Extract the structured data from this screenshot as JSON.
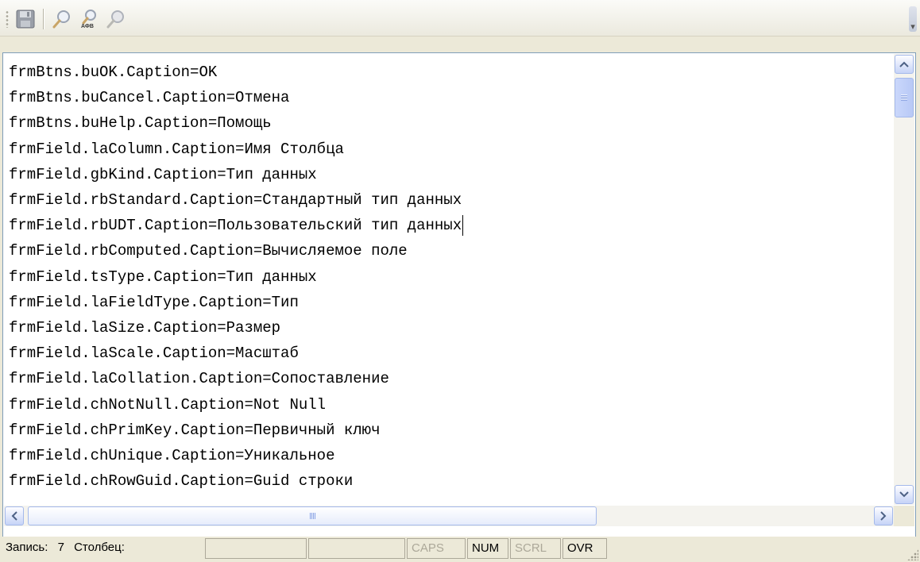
{
  "toolbar": {
    "buttons": [
      {
        "icon": "save-icon"
      },
      {
        "icon": "search-icon"
      },
      {
        "icon": "search-abc-icon",
        "label": "АФВ"
      },
      {
        "icon": "search-next-icon"
      }
    ]
  },
  "editor": {
    "lines": [
      "frmBtns.buOK.Caption=OK",
      "frmBtns.buCancel.Caption=Отмена",
      "frmBtns.buHelp.Caption=Помощь",
      "frmField.laColumn.Caption=Имя Столбца",
      "frmField.gbKind.Caption=Тип данных",
      "frmField.rbStandard.Caption=Стандартный тип данных",
      "frmField.rbUDT.Caption=Пользовательский тип данных",
      "frmField.rbComputed.Caption=Вычисляемое поле",
      "frmField.tsType.Caption=Тип данных",
      "frmField.laFieldType.Caption=Тип",
      "frmField.laSize.Caption=Размер",
      "frmField.laScale.Caption=Масштаб",
      "frmField.laCollation.Caption=Сопоставление",
      "frmField.chNotNull.Caption=Not Null",
      "frmField.chPrimKey.Caption=Первичный ключ",
      "frmField.chUnique.Caption=Уникальное",
      "frmField.chRowGuid.Caption=Guid строки"
    ],
    "caret_line": 7
  },
  "status": {
    "record_label": "Запись:",
    "record_value": "7",
    "column_label": "Столбец:",
    "column_value": "",
    "empty_panel": "",
    "caps": "CAPS",
    "num": "NUM",
    "scrl": "SCRL",
    "ovr": "OVR"
  },
  "colors": {
    "frame_border": "#7f9db9",
    "scroll_accent": "#a4b9eb",
    "disabled_text": "#aca899"
  }
}
